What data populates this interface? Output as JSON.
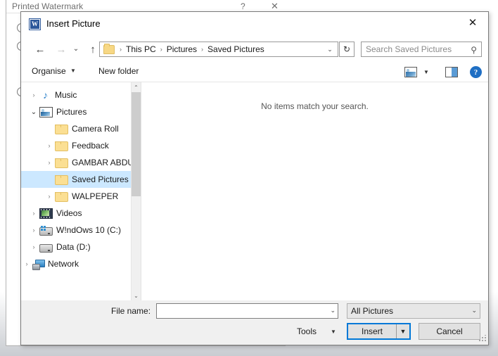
{
  "background_window": {
    "title": "Printed Watermark",
    "help_glyph": "?",
    "close_glyph": "✕"
  },
  "dialog": {
    "title": "Insert Picture",
    "app_icon_letter": "W",
    "close_glyph": "✕"
  },
  "nav": {
    "back_glyph": "←",
    "forward_glyph": "→",
    "recent_glyph": "⌄",
    "up_glyph": "↑",
    "address": {
      "folder_icon": "folder-icon",
      "crumbs": [
        "This PC",
        "Pictures",
        "Saved Pictures"
      ],
      "separator": "›",
      "dropdown_glyph": "⌄"
    },
    "refresh_glyph": "↻",
    "search": {
      "placeholder": "Search Saved Pictures",
      "icon_glyph": "⚲"
    }
  },
  "commandbar": {
    "organise_label": "Organise",
    "organise_arrow": "▼",
    "new_folder_label": "New folder",
    "view_dropdown_arrow": "▼",
    "help_glyph": "?"
  },
  "navpane": {
    "items": [
      {
        "label": "Music",
        "icon": "music-note-icon",
        "indent": 0,
        "twisty": "collapsed",
        "selected": false
      },
      {
        "label": "Pictures",
        "icon": "pictures-icon",
        "indent": 0,
        "twisty": "expanded",
        "selected": false
      },
      {
        "label": "Camera Roll",
        "icon": "folder-icon",
        "indent": 1,
        "twisty": "none",
        "selected": false
      },
      {
        "label": "Feedback",
        "icon": "folder-icon",
        "indent": 1,
        "twisty": "collapsed",
        "selected": false
      },
      {
        "label": "GAMBAR ABDU",
        "icon": "folder-icon",
        "indent": 1,
        "twisty": "collapsed",
        "selected": false
      },
      {
        "label": "Saved Pictures",
        "icon": "folder-icon",
        "indent": 1,
        "twisty": "none",
        "selected": true
      },
      {
        "label": "WALPEPER",
        "icon": "folder-icon",
        "indent": 1,
        "twisty": "collapsed",
        "selected": false
      },
      {
        "label": "Videos",
        "icon": "video-icon",
        "indent": 0,
        "twisty": "collapsed",
        "selected": false
      },
      {
        "label": "W!ndOws 10 (C:)",
        "icon": "drive-windows-icon",
        "indent": 0,
        "twisty": "collapsed",
        "selected": false
      },
      {
        "label": "Data (D:)",
        "icon": "drive-icon",
        "indent": 0,
        "twisty": "collapsed",
        "selected": false
      },
      {
        "label": "Network",
        "icon": "network-icon",
        "indent": -1,
        "twisty": "collapsed",
        "selected": false
      }
    ],
    "scroll_up_glyph": "⌃",
    "scroll_down_glyph": "⌄"
  },
  "filepane": {
    "empty_message": "No items match your search."
  },
  "footer": {
    "filename_label": "File name:",
    "filename_value": "",
    "filename_dropdown_glyph": "⌄",
    "filter_value": "All Pictures",
    "filter_dropdown_glyph": "⌄",
    "tools_label": "Tools",
    "tools_arrow": "▼",
    "insert_label": "Insert",
    "insert_split_arrow": "▼",
    "cancel_label": "Cancel"
  },
  "colors": {
    "accent": "#0078d7",
    "selection": "#cce8ff",
    "dialog_bg": "#f0f0f0",
    "word_blue": "#2b579a"
  }
}
